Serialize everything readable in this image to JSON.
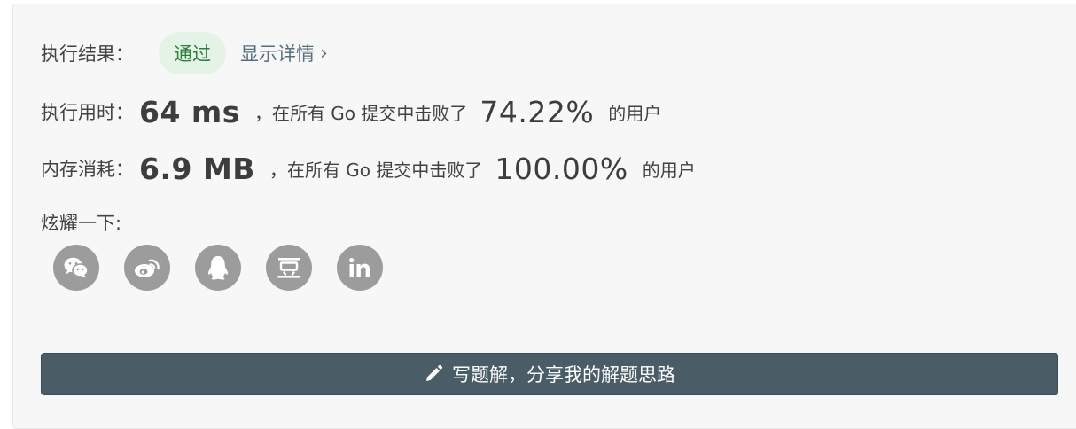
{
  "result": {
    "label": "执行结果：",
    "status": "通过",
    "detail_link": "显示详情"
  },
  "runtime": {
    "label": "执行用时：",
    "value": "64 ms",
    "mid_text": "，在所有 Go 提交中击败了",
    "percent": "74.22%",
    "suffix": "的用户"
  },
  "memory": {
    "label": "内存消耗：",
    "value": "6.9 MB",
    "mid_text": "，在所有 Go 提交中击败了",
    "percent": "100.00%",
    "suffix": "的用户"
  },
  "share": {
    "label": "炫耀一下:",
    "icons": [
      "wechat-icon",
      "weibo-icon",
      "qq-icon",
      "douban-icon",
      "linkedin-icon"
    ]
  },
  "write_solution": {
    "label": "写题解，分享我的解题思路"
  },
  "colors": {
    "panel_bg": "#f7f7f7",
    "badge_bg": "#e4f3e6",
    "badge_text": "#2f7d3c",
    "link": "#56707e",
    "icon_bg": "#9c9c9c",
    "button_bg": "#4a5c66"
  }
}
